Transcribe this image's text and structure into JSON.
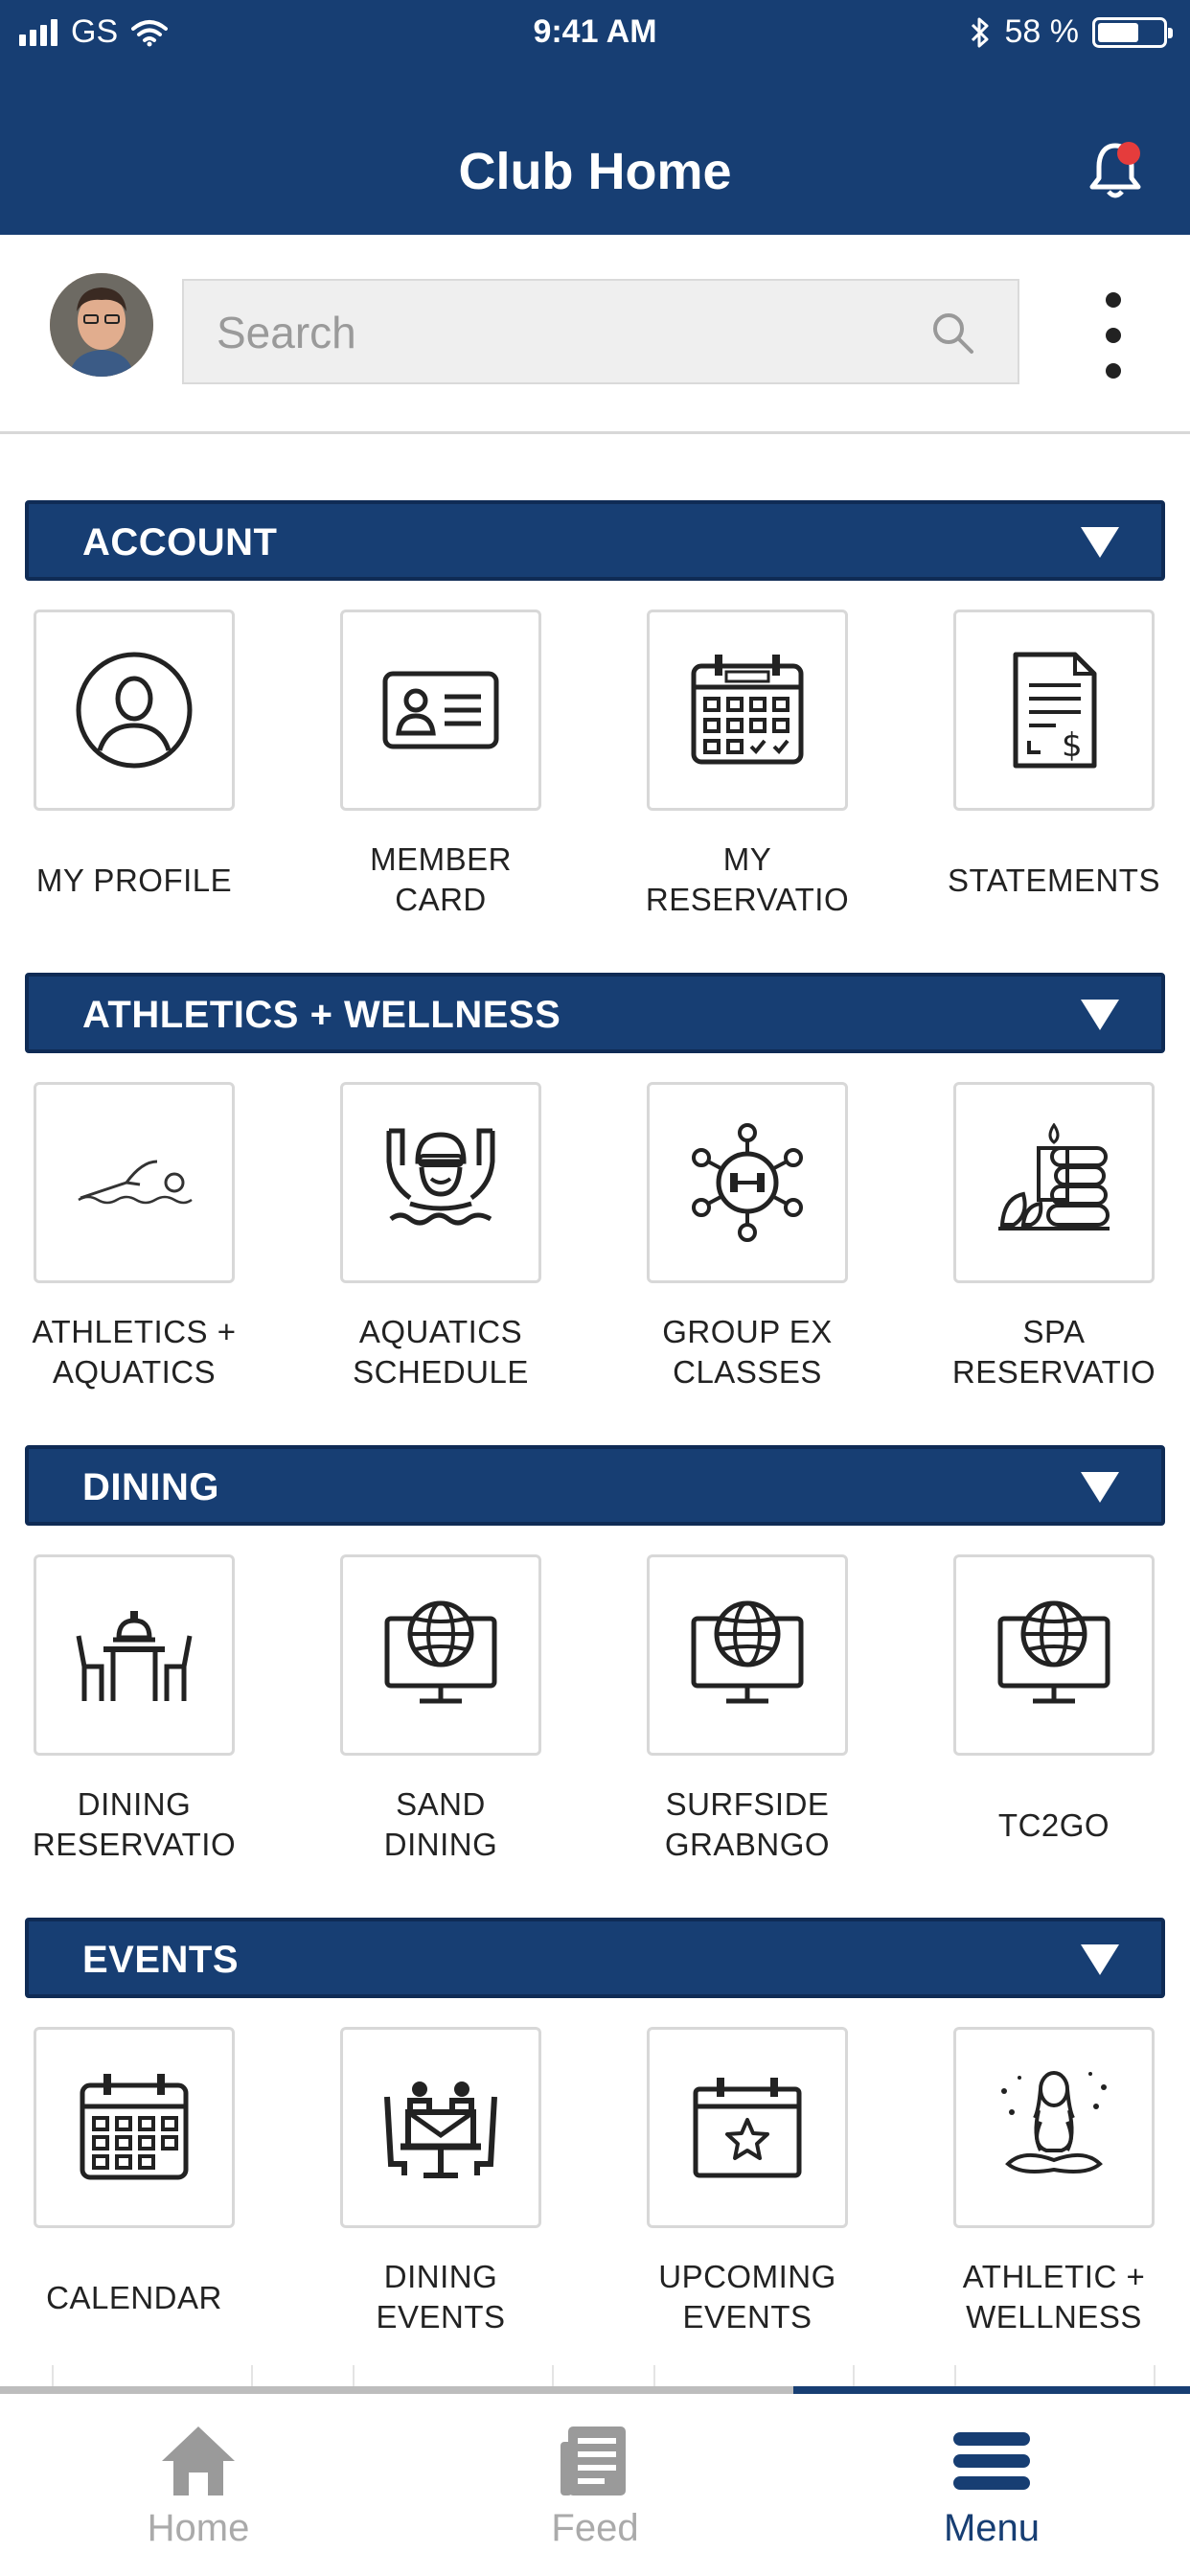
{
  "status_bar": {
    "carrier": "GS",
    "time": "9:41 AM",
    "battery": "58 %",
    "battery_level": 0.58
  },
  "header": {
    "title": "Club Home",
    "notification_dot": true
  },
  "search": {
    "placeholder": "Search"
  },
  "sections": [
    {
      "title": "ACCOUNT",
      "tiles": [
        {
          "line1": "MY PROFILE",
          "line2": "",
          "icon": "profile-icon"
        },
        {
          "line1": "MEMBER",
          "line2": "CARD",
          "icon": "id-card-icon"
        },
        {
          "line1": "MY",
          "line2": "RESERVATIO",
          "icon": "calendar-check-icon"
        },
        {
          "line1": "STATEMENTS",
          "line2": "",
          "icon": "invoice-icon"
        }
      ]
    },
    {
      "title": "ATHLETICS + WELLNESS",
      "tiles": [
        {
          "line1": "ATHLETICS +",
          "line2": "AQUATICS",
          "icon": "swimmer-icon"
        },
        {
          "line1": "AQUATICS",
          "line2": "SCHEDULE",
          "icon": "swim-cap-icon"
        },
        {
          "line1": "GROUP EX",
          "line2": "CLASSES",
          "icon": "dumbbell-group-icon"
        },
        {
          "line1": "SPA",
          "line2": "RESERVATIO",
          "icon": "spa-stones-icon"
        }
      ]
    },
    {
      "title": "DINING",
      "tiles": [
        {
          "line1": "DINING",
          "line2": "RESERVATIO",
          "icon": "dining-table-icon"
        },
        {
          "line1": "SAND",
          "line2": "DINING",
          "icon": "globe-monitor-icon"
        },
        {
          "line1": "SURFSIDE",
          "line2": "GRABNGO",
          "icon": "globe-monitor-icon"
        },
        {
          "line1": "TC2GO",
          "line2": "",
          "icon": "globe-monitor-icon"
        }
      ]
    },
    {
      "title": "EVENTS",
      "tiles": [
        {
          "line1": "CALENDAR",
          "line2": "",
          "icon": "calendar-icon"
        },
        {
          "line1": "DINING",
          "line2": "EVENTS",
          "icon": "dining-event-icon"
        },
        {
          "line1": "UPCOMING",
          "line2": "EVENTS",
          "icon": "calendar-star-icon"
        },
        {
          "line1": "ATHLETIC +",
          "line2": "WELLNESS",
          "icon": "meditation-icon"
        }
      ]
    }
  ],
  "tab_bar": {
    "tabs": [
      {
        "label": "Home",
        "icon": "home-icon",
        "active": false
      },
      {
        "label": "Feed",
        "icon": "feed-icon",
        "active": false
      },
      {
        "label": "Menu",
        "icon": "menu-icon",
        "active": true
      }
    ]
  },
  "colors": {
    "primary": "#173e73",
    "notification": "#e53c3c",
    "tile_border": "#d8d8d8",
    "inactive_tab": "#aaaaaa"
  }
}
